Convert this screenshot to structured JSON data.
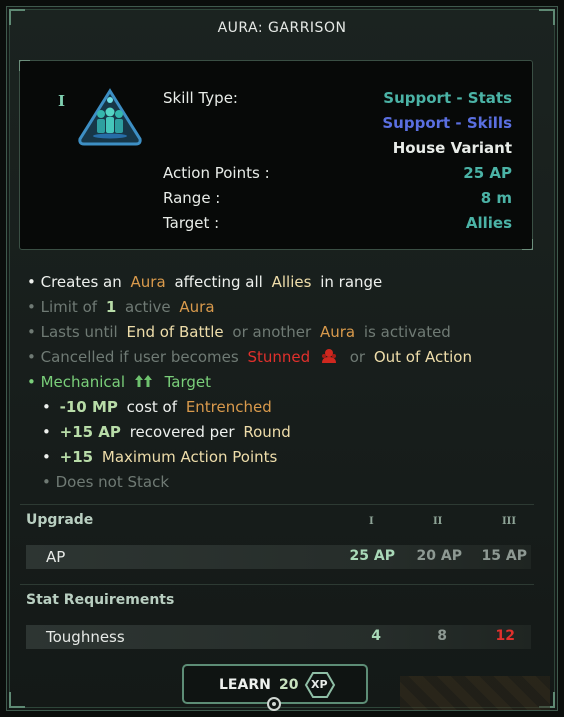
{
  "window": {
    "title": "AURA: GARRISON"
  },
  "skill": {
    "tier_mark": "I",
    "icon": "garrison-aura-icon",
    "stats": [
      {
        "label": "Skill Type:",
        "value": "Support - Stats",
        "color": "#4bb3a6"
      },
      {
        "label": "",
        "value": "Support - Skills",
        "color": "#5a6fe0"
      },
      {
        "label": "",
        "value": "House Variant",
        "color": "#e8ece8"
      },
      {
        "label": "Action Points :",
        "value": "25 AP",
        "color": "#4bb3a6"
      },
      {
        "label": "Range :",
        "value": "8 m",
        "color": "#4bb3a6"
      },
      {
        "label": "Target :",
        "value": "Allies",
        "color": "#4bb3a6"
      }
    ]
  },
  "effects": {
    "line1": {
      "a": "• Creates an",
      "b": "Aura",
      "c": "affecting all",
      "d": "Allies",
      "e": "in range"
    },
    "line2": {
      "a": "• Limit of",
      "b": "1",
      "c": "active",
      "d": "Aura"
    },
    "line3": {
      "a": "• Lasts until",
      "b": "End of Battle",
      "c": "or another",
      "d": "Aura",
      "e": "is activated"
    },
    "line4": {
      "a": "• Cancelled if user becomes",
      "b": "Stunned",
      "c": "or",
      "d": "Out of Action"
    },
    "line5": {
      "a": "• Mechanical",
      "b": "Target"
    },
    "line6": {
      "a": "•",
      "b": "-10 MP",
      "c": "cost of",
      "d": "Entrenched"
    },
    "line7": {
      "a": "•",
      "b": "+15 AP",
      "c": "recovered per",
      "d": "Round"
    },
    "line8": {
      "a": "•",
      "b": "+15",
      "c": "Maximum Action Points"
    },
    "line9": {
      "a": "• Does not Stack"
    }
  },
  "upgrade": {
    "header": "Upgrade",
    "tiers": [
      "I",
      "II",
      "III"
    ],
    "row": {
      "label": "AP",
      "values": [
        "25 AP",
        "20 AP",
        "15 AP"
      ]
    }
  },
  "requirements": {
    "header": "Stat Requirements",
    "row": {
      "label": "Toughness",
      "values": [
        "4",
        "8",
        "12"
      ]
    }
  },
  "learn": {
    "label": "LEARN",
    "cost": "20",
    "currency": "XP"
  },
  "colors": {
    "accent": "#5d8d76",
    "teal": "#4bb3a6",
    "orange": "#d99a4c",
    "red": "#e0302c",
    "green": "#7acf7a"
  }
}
